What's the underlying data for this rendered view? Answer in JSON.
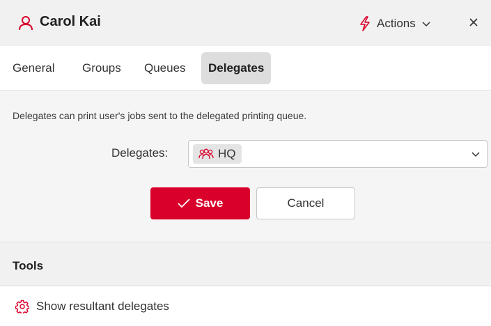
{
  "header": {
    "user_name": "Carol Kai",
    "actions_label": "Actions"
  },
  "tabs": [
    {
      "label": "General",
      "active": false
    },
    {
      "label": "Groups",
      "active": false
    },
    {
      "label": "Queues",
      "active": false
    },
    {
      "label": "Delegates",
      "active": true
    }
  ],
  "delegates": {
    "description": "Delegates can print user's jobs sent to the delegated printing queue.",
    "field_label": "Delegates:",
    "selected_chip": "HQ",
    "save_label": "Save",
    "cancel_label": "Cancel"
  },
  "tools": {
    "title": "Tools",
    "link_label": "Show resultant delegates"
  },
  "colors": {
    "accent": "#d9002b",
    "header_bg": "#f1f1f1",
    "section_bg": "#f5f5f5"
  },
  "icons": {
    "user": "user-icon",
    "actions": "lightning-icon",
    "close": "close-icon",
    "group": "group-icon",
    "save": "checkmark-icon",
    "tool": "gear-icon"
  }
}
